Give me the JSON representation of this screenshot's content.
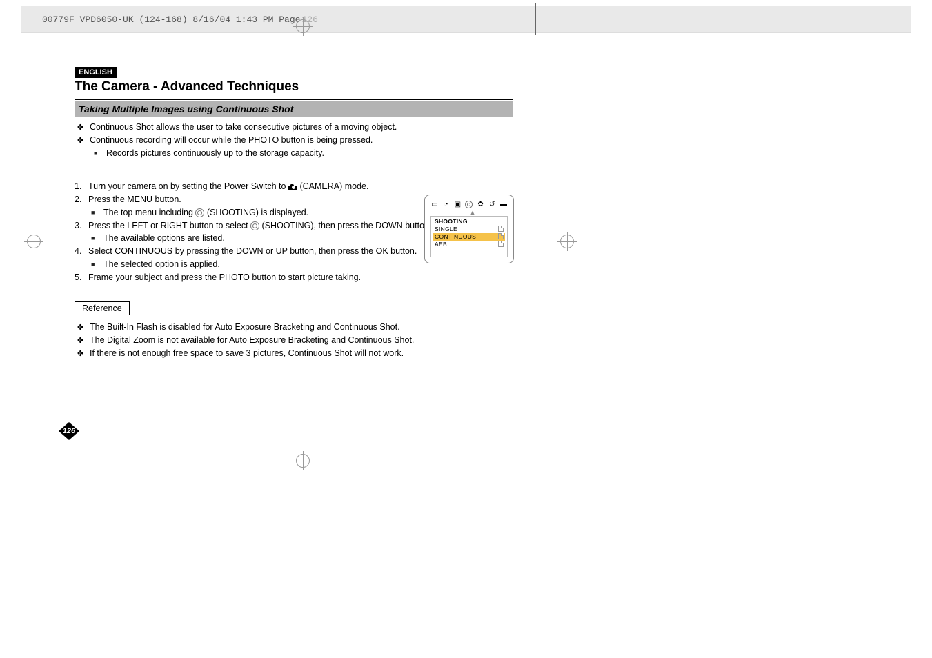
{
  "header": {
    "slug": "00779F VPD6050-UK (124-168)  8/16/04 1:43 PM  Page",
    "page_in_slug": "126"
  },
  "lang_badge": "ENGLISH",
  "title": "The Camera - Advanced Techniques",
  "section": "Taking Multiple Images using Continuous Shot",
  "intro": {
    "b1": "Continuous Shot allows the user to take consecutive pictures of a moving object.",
    "b2": "Continuous recording will occur while the PHOTO button is being pressed.",
    "b2_sub": "Records pictures continuously up to the storage capacity."
  },
  "steps": {
    "s1_a": "Turn your camera on by setting the Power Switch to ",
    "s1_b": "(CAMERA) mode.",
    "s2": "Press the MENU button.",
    "s2_sub_a": "The top menu including ",
    "s2_sub_b": " (SHOOTING) is displayed.",
    "s3_a": "Press the LEFT or RIGHT button to select ",
    "s3_b": " (SHOOTING), then press the DOWN button.",
    "s3_sub": "The available options are listed.",
    "s4": "Select CONTINUOUS by pressing the DOWN or UP button, then press the OK button.",
    "s4_sub": "The selected option is applied.",
    "s5": "Frame your subject and press the PHOTO button to start picture taking."
  },
  "reference_label": "Reference",
  "refs": {
    "r1": "The Built-In Flash is disabled for Auto Exposure Bracketing and Continuous Shot.",
    "r2": "The Digital Zoom is not available for Auto Exposure Bracketing and Continuous Shot.",
    "r3": "If there is not enough free space to save 3 pictures, Continuous Shot will not work."
  },
  "lcd": {
    "heading": "SHOOTING",
    "opt1": "SINGLE",
    "opt2": "CONTINUOUS",
    "opt3": "AEB"
  },
  "page_number": "126"
}
